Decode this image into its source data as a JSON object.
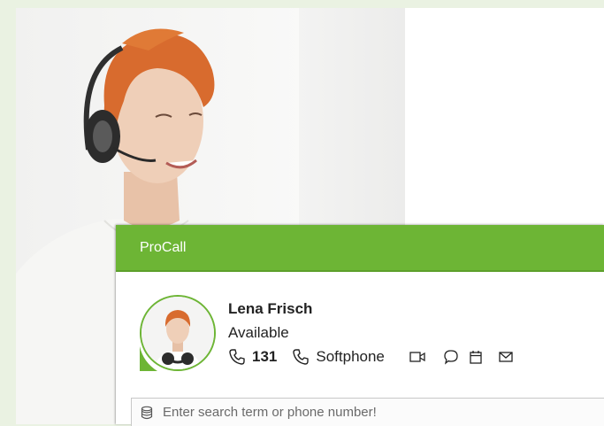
{
  "app": {
    "title": "ProCall",
    "accent_color": "#6db535"
  },
  "contact": {
    "name": "Lena Frisch",
    "status": "Available",
    "status_color": "#6db535",
    "extension": "131",
    "device": "Softphone"
  },
  "actions": {
    "icons": [
      "phone-icon",
      "softphone-icon",
      "video-icon",
      "chat-icon",
      "calendar-icon",
      "mail-icon"
    ]
  },
  "search": {
    "placeholder": "Enter search term or phone number!",
    "value": "",
    "icon": "database-icon"
  }
}
